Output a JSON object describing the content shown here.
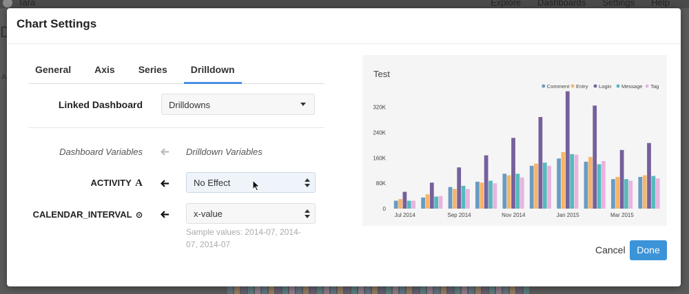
{
  "background": {
    "user": "Tara",
    "nav": [
      "Explore",
      "Dashboards",
      "Settings",
      "Help"
    ]
  },
  "modal": {
    "title": "Chart Settings",
    "tabs": [
      "General",
      "Axis",
      "Series",
      "Drilldown"
    ],
    "active_tab": "Drilldown",
    "linked_dashboard": {
      "label": "Linked Dashboard",
      "value": "Drilldowns"
    },
    "variables_header": {
      "left": "Dashboard Variables",
      "right": "Drilldown Variables"
    },
    "mappings": [
      {
        "name": "ACTIVITY",
        "type_icon": "text-type-icon",
        "type_glyph": "A",
        "value": "No Effect"
      },
      {
        "name": "CALENDAR_INTERVAL",
        "type_icon": "clock-type-icon",
        "type_glyph": "⊙",
        "value": "x-value"
      }
    ],
    "sample_values": "Sample values: 2014-07, 2014-07, 2014-07",
    "cancel_label": "Cancel",
    "done_label": "Done"
  },
  "chart_data": {
    "type": "bar",
    "title": "Test",
    "legend_position": "top-right",
    "series": [
      {
        "name": "Comment",
        "color": "#6a9bc3",
        "values": [
          25000,
          35000,
          68000,
          85000,
          110000,
          135000,
          158000,
          148000,
          93000,
          100000
        ]
      },
      {
        "name": "Entry",
        "color": "#f6b56a",
        "values": [
          30000,
          45000,
          62000,
          82000,
          105000,
          142000,
          178000,
          163000,
          100000,
          105000
        ]
      },
      {
        "name": "Login",
        "color": "#76609c",
        "values": [
          53000,
          82000,
          130000,
          168000,
          223000,
          289000,
          370000,
          325000,
          185000,
          207000
        ]
      },
      {
        "name": "Message",
        "color": "#56b9bd",
        "values": [
          25000,
          38000,
          72000,
          88000,
          110000,
          145000,
          172000,
          140000,
          93000,
          103000
        ]
      },
      {
        "name": "Tag",
        "color": "#e8b4df",
        "values": [
          25000,
          40000,
          62000,
          80000,
          98000,
          135000,
          170000,
          150000,
          88000,
          95000
        ]
      }
    ],
    "x_ticks": [
      "Jul 2014",
      "Sep 2014",
      "Nov 2014",
      "Jan 2015",
      "Mar 2015"
    ],
    "y_ticks": [
      "0",
      "80K",
      "160K",
      "240K",
      "320K"
    ],
    "ylim": [
      0,
      380000
    ],
    "grid": false
  }
}
